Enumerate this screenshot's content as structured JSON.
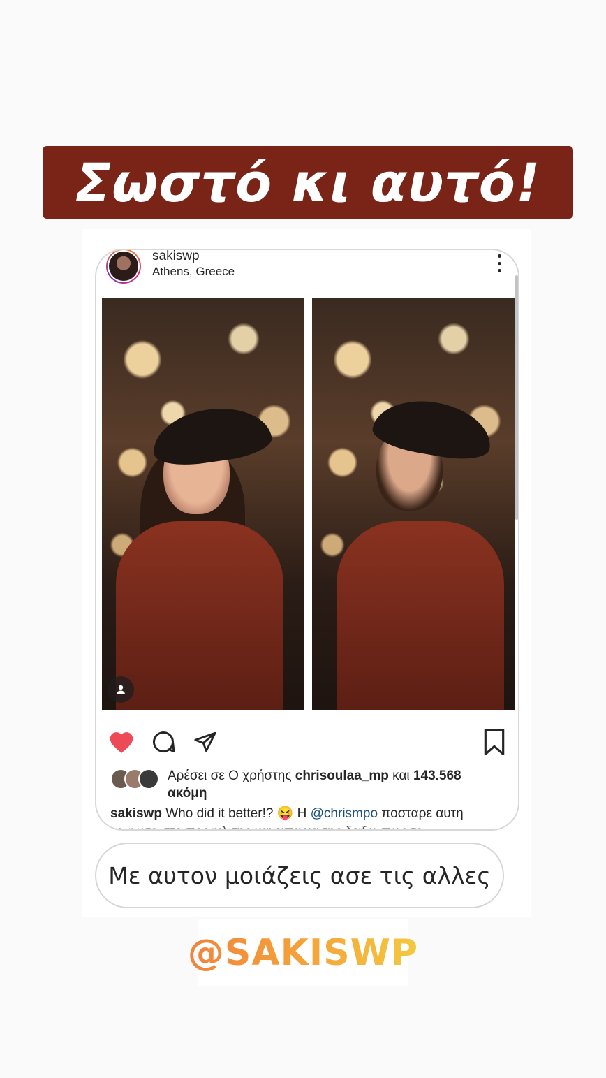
{
  "headline": "Σωστό κι αυτό!",
  "post": {
    "username": "sakiswp",
    "location": "Athens, Greece",
    "likes": {
      "prefix": "Αρέσει σε Ο χρήστης",
      "user": "chrisoulaa_mp",
      "middle": "και",
      "count": "143.568",
      "suffix": "ακόμη"
    },
    "caption": {
      "user": "sakiswp",
      "text": "Who did it better!? 😝 Η",
      "mention": "@chrismpo",
      "rest": "ποσταρε αυτη",
      "second_line": "τη φωτο στο προφιλ της και ειπα να της δειξω πως το"
    }
  },
  "reply": "Με αυτον μοιάζεις ασε τις αλλες",
  "mention_sticker": "@SAKISWP",
  "colors": {
    "headline_bg": "#7a2418",
    "like_heart": "#ed4956",
    "mention_link": "#1a4f7a",
    "sticker_gradient": [
      "#f0843c",
      "#f3c93f"
    ]
  },
  "icons": [
    "more-vertical-icon",
    "person-tag-icon",
    "heart-filled-icon",
    "comment-icon",
    "share-icon",
    "bookmark-icon"
  ]
}
